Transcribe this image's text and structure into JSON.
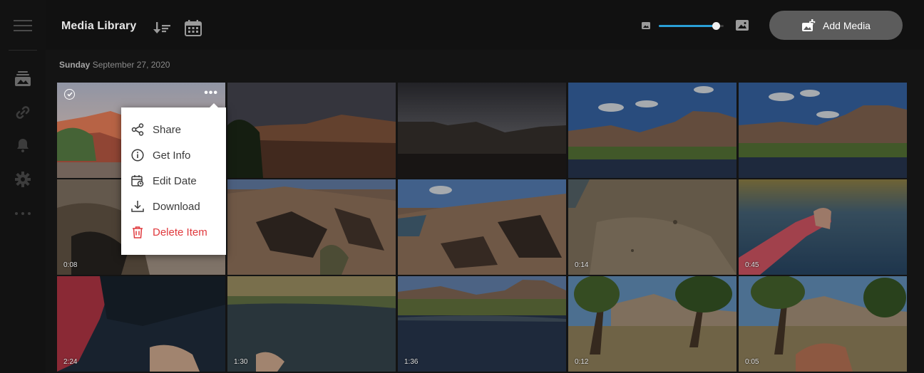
{
  "header": {
    "title": "Media Library",
    "sort_icon": "sort-descending-icon",
    "calendar_icon": "calendar-icon",
    "zoom": {
      "level": 0.88,
      "small_icon": "image-small-icon",
      "large_icon": "image-large-icon"
    },
    "add_button": {
      "label": "Add Media",
      "icon": "add-media-icon"
    }
  },
  "sidebar": {
    "items": [
      {
        "name": "menu",
        "icon": "hamburger-icon"
      },
      {
        "name": "library",
        "icon": "media-library-icon"
      },
      {
        "name": "links",
        "icon": "link-icon"
      },
      {
        "name": "notifications",
        "icon": "bell-icon"
      },
      {
        "name": "settings",
        "icon": "gear-icon"
      },
      {
        "name": "more",
        "icon": "more-horizontal-icon"
      }
    ]
  },
  "section": {
    "day": "Sunday",
    "date": "September 27, 2020"
  },
  "tiles": [
    {
      "scene": "desert-sunset",
      "duration": ""
    },
    {
      "scene": "dusk-hills",
      "duration": ""
    },
    {
      "scene": "night-hills",
      "duration": ""
    },
    {
      "scene": "river-day",
      "duration": ""
    },
    {
      "scene": "river-day-2",
      "duration": ""
    },
    {
      "scene": "rocks-closeup",
      "duration": "0:08"
    },
    {
      "scene": "rocky-slope",
      "duration": ""
    },
    {
      "scene": "rocky-slope-sky",
      "duration": ""
    },
    {
      "scene": "dirt-ground",
      "duration": "0:14"
    },
    {
      "scene": "river-arm",
      "duration": "0:45"
    },
    {
      "scene": "pink-underwater",
      "duration": "2:24"
    },
    {
      "scene": "river-bank",
      "duration": "1:30"
    },
    {
      "scene": "river-mesa",
      "duration": "1:36"
    },
    {
      "scene": "trees-desert",
      "duration": "0:12"
    },
    {
      "scene": "trees-desert-2",
      "duration": "0:05"
    }
  ],
  "menu": {
    "items": [
      {
        "label": "Share",
        "icon": "share-icon"
      },
      {
        "label": "Get Info",
        "icon": "info-icon"
      },
      {
        "label": "Edit Date",
        "icon": "edit-date-icon"
      },
      {
        "label": "Download",
        "icon": "download-icon"
      },
      {
        "label": "Delete Item",
        "icon": "trash-icon"
      }
    ]
  },
  "colors": {
    "accent": "#2a9fd6",
    "danger": "#e0383c",
    "button_bg": "#5c5c5c"
  }
}
